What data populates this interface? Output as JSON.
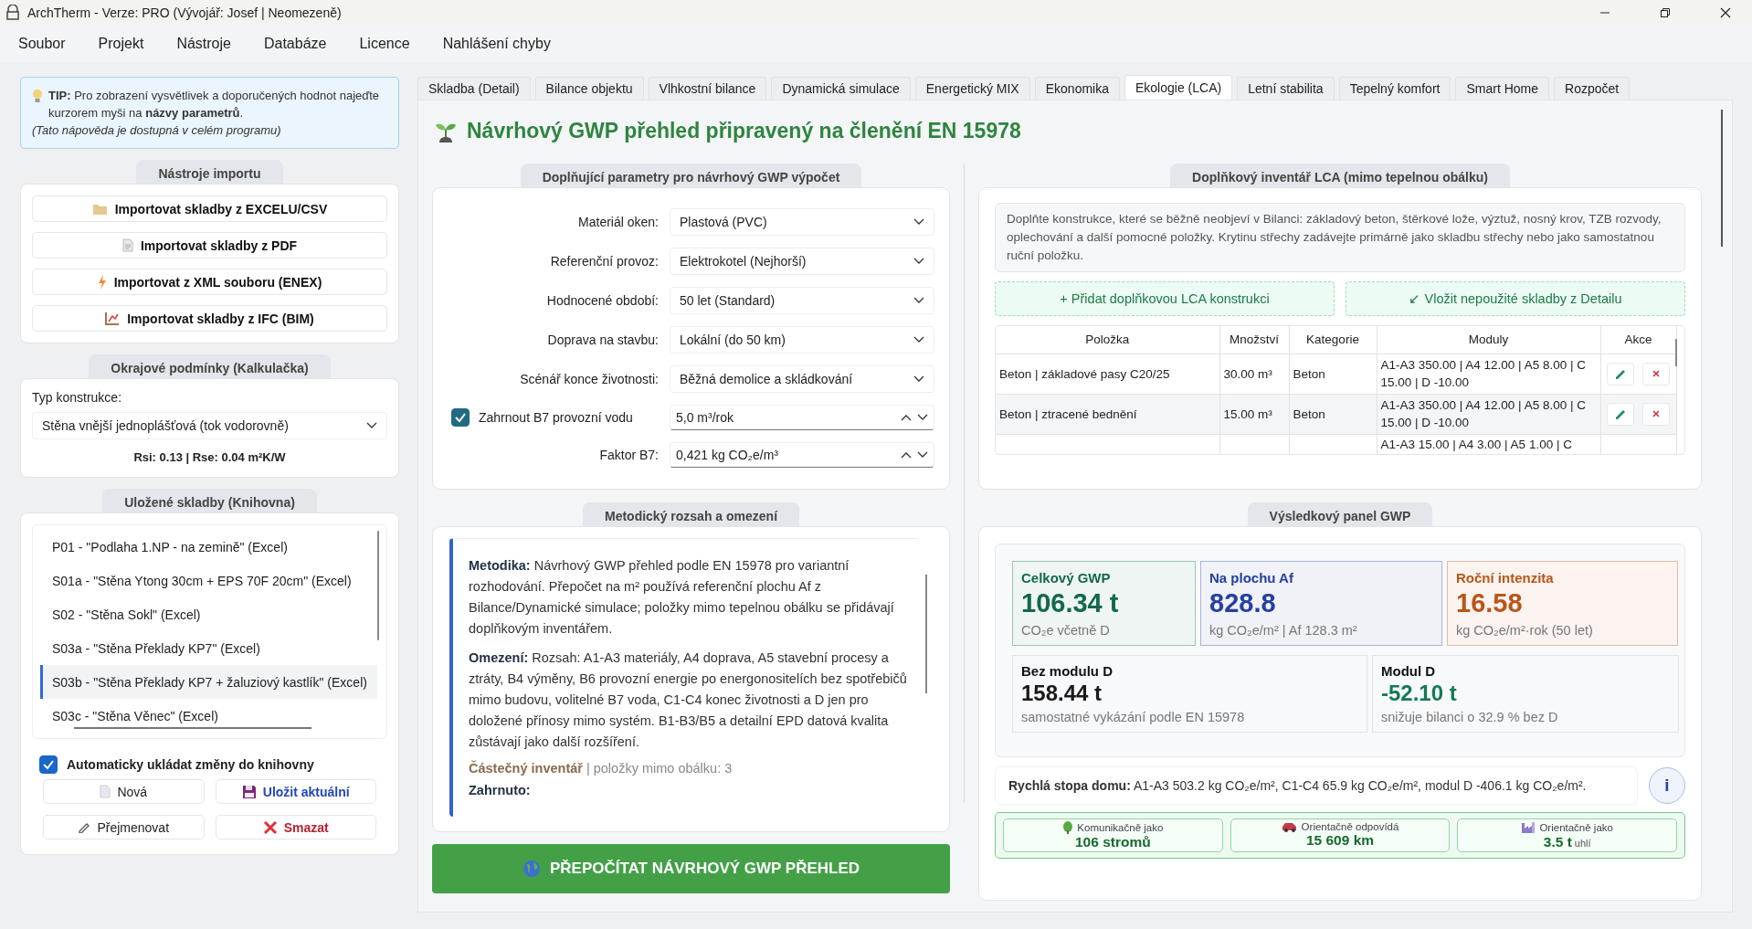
{
  "window": {
    "title": "ArchTherm - Verze: PRO (Vývojář: Josef | Neomezeně)"
  },
  "menu": [
    "Soubor",
    "Projekt",
    "Nástroje",
    "Databáze",
    "Licence",
    "Nahlášení chyby"
  ],
  "tip": {
    "text": "**TIP:** Pro zobrazení vysvětlivek a doporučených hodnot najeďte kurzorem myši na **názvy parametrů**.",
    "note": "(Tato nápověda je dostupná v celém programu)"
  },
  "import_tools": {
    "title": "Nástroje importu",
    "buttons": [
      {
        "label": "Importovat skladby z EXCELU/CSV",
        "kind": "excel"
      },
      {
        "label": "Importovat skladby z PDF",
        "kind": "pdf"
      },
      {
        "label": "Importovat z XML souboru (ENEX)",
        "kind": "xml"
      },
      {
        "label": "Importovat skladby z IFC (BIM)",
        "kind": "ifc"
      }
    ]
  },
  "boundary": {
    "title": "Okrajové podmínky (Kalkulačka)",
    "field_label": "Typ konstrukce:",
    "value": "Stěna vnější jednoplášťová (tok vodorovně)",
    "result": "Rsi: 0.13 | Rse: 0.04 m²K/W"
  },
  "library": {
    "title": "Uložené skladby (Knihovna)",
    "items": [
      {
        "label": "P01 - \"Podlaha 1.NP - na zemině\" (Excel)",
        "selected": false
      },
      {
        "label": "S01a - \"Stěna Ytong 30cm + EPS 70F 20cm\" (Excel)",
        "selected": false
      },
      {
        "label": "S02 - \"Stěna Sokl\" (Excel)",
        "selected": false
      },
      {
        "label": "S03a - \"Stěna Překlady KP7\" (Excel)",
        "selected": false
      },
      {
        "label": "S03b - \"Stěna Překlady KP7 + žaluziový kastlík\" (Excel)",
        "selected": true
      },
      {
        "label": "S03c - \"Stěna Věnec\" (Excel)",
        "selected": false
      }
    ],
    "autosave": {
      "label": "Automaticky ukládat změny do knihovny",
      "checked": true
    },
    "buttons": [
      {
        "label": "Nová",
        "kind": "new"
      },
      {
        "label": "Uložit aktuální",
        "kind": "save"
      },
      {
        "label": "Přejmenovat",
        "kind": "rename"
      },
      {
        "label": "Smazat",
        "kind": "delete"
      }
    ]
  },
  "tabs": [
    {
      "label": "Skladba (Detail)",
      "selected": false
    },
    {
      "label": "Bilance objektu",
      "selected": false
    },
    {
      "label": "Vlhkostní bilance",
      "selected": false
    },
    {
      "label": "Dynamická simulace",
      "selected": false
    },
    {
      "label": "Energetický MIX",
      "selected": false
    },
    {
      "label": "Ekonomika",
      "selected": false
    },
    {
      "label": "Ekologie (LCA)",
      "selected": true
    },
    {
      "label": "Letní stabilita",
      "selected": false
    },
    {
      "label": "Tepelný komfort",
      "selected": false
    },
    {
      "label": "Smart Home",
      "selected": false
    },
    {
      "label": "Rozpočet",
      "selected": false
    }
  ],
  "heading": "Návrhový GWP přehled připravený na členění EN 15978",
  "parameters": {
    "title": "Doplňující parametry pro návrhový GWP výpočet",
    "fields": [
      {
        "kind": "select",
        "label": "Materiál oken:",
        "value": "Plastová (PVC)"
      },
      {
        "kind": "select",
        "label": "Referenční provoz:",
        "value": "Elektrokotel (Nejhorší)"
      },
      {
        "kind": "select",
        "label": "Hodnocené období:",
        "value": "50 let (Standard)"
      },
      {
        "kind": "select",
        "label": "Doprava na stavbu:",
        "value": "Lokální (do 50 km)"
      },
      {
        "kind": "select",
        "label": "Scénář konce životnosti:",
        "value": "Běžná demolice a skládkování"
      },
      {
        "kind": "check-spin",
        "label": "Zahrnout B7 provozní vodu",
        "value": "5,0 m³/rok",
        "checked": true
      },
      {
        "kind": "spin",
        "label": "Faktor B7:",
        "value": "0,421 kg CO₂e/m³"
      }
    ]
  },
  "method": {
    "title": "Metodický rozsah a omezení",
    "paragraphs": [
      "**Metodika:** Návrhový GWP přehled podle EN 15978 pro variantní rozhodování. Přepočet na m² používá referenční plochu Af z Bilance/Dynamické simulace; položky mimo tepelnou obálku se přidávají doplňkovým inventářem.",
      "**Omezení:** Rozsah: A1-A3 materiály, A4 doprava, A5 stavební procesy a ztráty, B4 výměny, B6 provozní energie po energonositelích bez spotřebičů mimo budovu, volitelné B7 voda, C1-C4 konec životnosti a D jen pro doložené přínosy mimo systém. B1-B3/B5 a detailní EPD datová kvalita zůstávají jako další rozšíření."
    ],
    "status": "**Částečný inventář** | položky mimo obálku: 3",
    "subheading": "Zahrnuto:"
  },
  "recalc_button": "PŘEPOČÍTAT NÁVRHOVÝ GWP PŘEHLED",
  "inventory": {
    "title": "Doplňkový inventář LCA (mimo tepelnou obálku)",
    "note": "Doplňte konstrukce, které se běžně neobjeví v Bilanci: základový beton, štěrkové lože, výztuž, nosný krov, TZB rozvody, oplechování a další pomocné položky. Krytinu střechy zadávejte primárně jako skladbu střechy nebo jako samostatnou ruční položku.",
    "buttons": [
      "+ Přidat doplňkovou LCA konstrukci",
      "↙ Vložit nepoužité skladby z Detailu"
    ],
    "table": {
      "columns": [
        "Položka",
        "Množství",
        "Kategorie",
        "Moduly",
        "Akce"
      ],
      "rows": [
        {
          "item": "Beton | základové pasy C20/25",
          "quantity": "30.00 m³",
          "category": "Beton",
          "modules": "A1-A3 350.00 | A4 12.00 | A5 8.00 | C 15.00 | D -10.00",
          "actions": true
        },
        {
          "item": "Beton | ztracené bednění",
          "quantity": "15.00 m³",
          "category": "Beton",
          "modules": "A1-A3 350.00 | A4 12.00 | A5 8.00 | C 15.00 | D -10.00",
          "actions": true
        },
        {
          "modules": "A1-A3 15.00 | A4 3.00 | A5 1.00 | C",
          "actions": false
        }
      ]
    }
  },
  "results": {
    "title": "Výsledkový panel GWP",
    "metrics": [
      {
        "kind": "highlight",
        "label": "Celkový GWP",
        "value": "106.34 t",
        "note": "CO₂e včetně D",
        "color": "#12694a"
      },
      {
        "kind": "highlight",
        "label": "Na plochu Af",
        "value": "828.8",
        "note": "kg CO₂e/m² | Af 128.3 m²",
        "color": "#2540a0"
      },
      {
        "kind": "highlight",
        "label": "Roční intenzita",
        "value": "16.58",
        "note": "kg CO₂e/m²·rok (50 let)",
        "color": "#b8561a"
      },
      {
        "kind": "plain",
        "label": "Bez modulu D",
        "value": "158.44 t",
        "note": "samostatné vykázání podle EN 15978",
        "color": "#1a1a1a"
      },
      {
        "kind": "plain",
        "label": "Modul D",
        "value": "-52.10 t",
        "note": "snižuje bilanci o 32.9 % bez D",
        "color": "#137a55"
      }
    ],
    "footprint": "**Rychlá stopa domu:** A1-A3 503.2 kg CO₂e/m², C1-C4 65.9 kg CO₂e/m², modul D -406.1 kg CO₂e/m².",
    "info_button": "i",
    "equivalents": [
      {
        "kind": "trees",
        "label": "Komunikačně jako",
        "value": "106 stromů"
      },
      {
        "kind": "distance",
        "label": "Orientačně odpovídá",
        "value": "15 609 km"
      },
      {
        "kind": "coal",
        "label": "Orientačně jako",
        "value": "3.5 t",
        "unit": "uhlí"
      }
    ]
  }
}
